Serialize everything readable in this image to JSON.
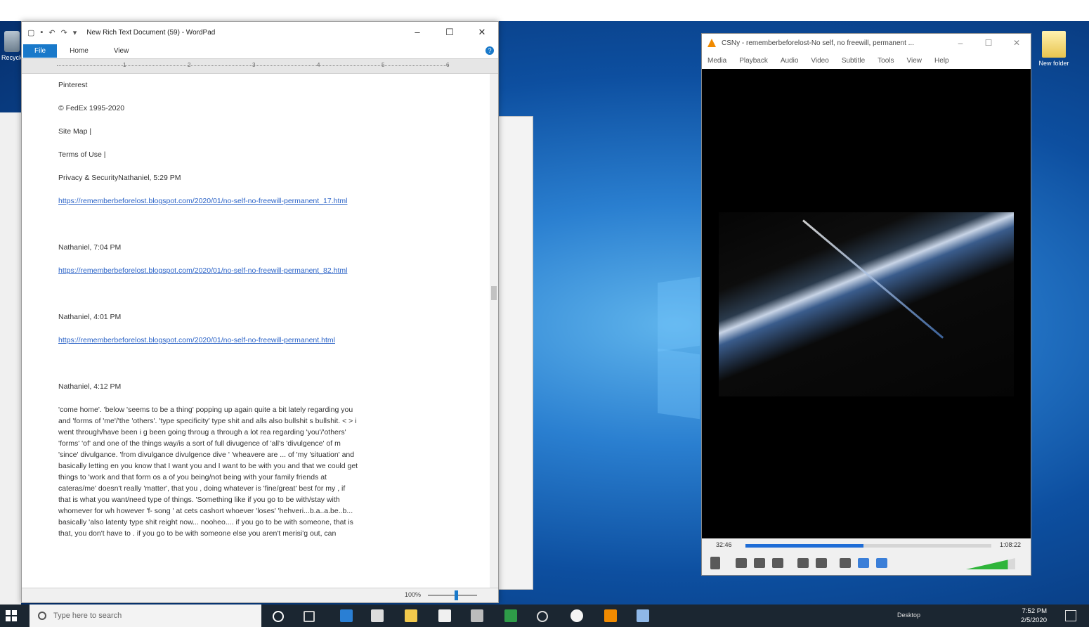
{
  "desktop": {
    "icons": [
      {
        "label": "Recycle",
        "icon": "recycle-bin-icon"
      },
      {
        "label": "New folder",
        "icon": "folder-icon"
      }
    ]
  },
  "wordpad": {
    "title": "New Rich Text Document (59) - WordPad",
    "tabs": {
      "file": "File",
      "home": "Home",
      "view": "View"
    },
    "help_glyph": "?",
    "ruler_numbers": [
      "1",
      "2",
      "3",
      "4",
      "5",
      "6"
    ],
    "lines": [
      {
        "kind": "plain",
        "text": "Pinterest"
      },
      {
        "kind": "plain",
        "text": "© FedEx 1995-2020"
      },
      {
        "kind": "plain",
        "text": "Site Map |"
      },
      {
        "kind": "plain",
        "text": "Terms of Use |"
      },
      {
        "kind": "plain",
        "text": "Privacy & SecurityNathaniel, 5:29 PM"
      },
      {
        "kind": "link",
        "text": "https://rememberbeforelost.blogspot.com/2020/01/no-self-no-freewill-permanent_17.html"
      },
      {
        "kind": "gap",
        "text": ""
      },
      {
        "kind": "plain",
        "text": "Nathaniel, 7:04 PM"
      },
      {
        "kind": "link",
        "text": "https://rememberbeforelost.blogspot.com/2020/01/no-self-no-freewill-permanent_82.html"
      },
      {
        "kind": "gap",
        "text": ""
      },
      {
        "kind": "plain",
        "text": "Nathaniel, 4:01 PM"
      },
      {
        "kind": "link",
        "text": "https://rememberbeforelost.blogspot.com/2020/01/no-self-no-freewill-permanent.html"
      },
      {
        "kind": "gap",
        "text": ""
      },
      {
        "kind": "plain",
        "text": "Nathaniel, 4:12 PM"
      }
    ],
    "paragraph": [
      "'come home'. 'below 'seems to be a thing' popping up again quite a bit lately regarding you",
      "and 'forms of 'me'/'the 'others'. 'type specificity' type shit and alls also bullshit s bullshit. < > i",
      "went through/have been i g been going throug a through a lot rea regarding 'you'/'others'",
      "'forms' 'of' and one of the things way/is a sort of full divugence of 'all's 'divulgence' of m",
      "'since' divulgance. 'from divulgance divulgence dive ' 'wheavere are ... of 'my 'situation' and",
      "basically letting en you know that I want you and I want to be with you and that we could get",
      "things to 'work and that form os a of you being/not being with your family friends at",
      "cateras/me' doesn't really 'matter', that you , doing whatever is 'fine/great' best for my , if",
      "that is what you want/need type of things. 'Something like if you go to be with/stay with",
      "whomever for wh however 'f- song ' at cets cashort whoever 'loses' 'hehveri...b.a..a.be..b...",
      "basically 'also latenty type shit reight now... nooheo.... if you go to be with someone, that is",
      "that, you don't have to . if you go to be with someone else you aren't merisi'g out, can"
    ],
    "status": {
      "zoom": "100%"
    }
  },
  "vlc": {
    "title": "CSNy - rememberbeforelost-No self, no freewill, permanent ...",
    "menu": [
      "Media",
      "Playback",
      "Audio",
      "Video",
      "Subtitle",
      "Tools",
      "View",
      "Help"
    ],
    "time_current": "32:46",
    "time_total": "1:08:22",
    "progress": 0.48,
    "volume": 0.85
  },
  "taskbar": {
    "search_placeholder": "Type here to search",
    "desktop_label": "Desktop",
    "clock_time": "7:52 PM",
    "clock_date": "2/5/2020"
  },
  "colors": {
    "accent": "#1979ca",
    "link": "#2b63c7",
    "vlc_orange": "#f08a00",
    "taskbar": "#1b2631"
  }
}
